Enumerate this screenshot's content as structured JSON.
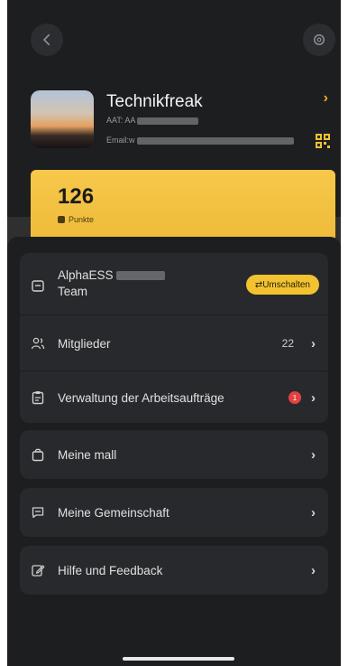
{
  "profile": {
    "name": "Technikfreak",
    "aat_prefix": "AAT: AA",
    "email_prefix": "Email:w"
  },
  "points": {
    "value": "126",
    "label": "Punkte"
  },
  "team": {
    "name_line1": "AlphaESS",
    "name_line2": "Team",
    "switch_label": "⇄Umschalten"
  },
  "menu": {
    "members_label": "Mitglieder",
    "members_count": "22",
    "work_orders_label": "Verwaltung der Arbeitsaufträge",
    "work_orders_badge": "1",
    "mall_label": "Meine mall",
    "community_label": "Meine Gemeinschaft",
    "help_label": "Hilfe und Feedback"
  },
  "colors": {
    "accent": "#f3c231",
    "background": "#1d1e20",
    "card": "#28292c",
    "badge": "#e34141"
  },
  "icons": {
    "back": "arrow-left-icon",
    "settings": "gear-icon",
    "qr": "qr-code-icon",
    "team": "team-icon",
    "members": "people-icon",
    "work_orders": "clipboard-icon",
    "mall": "shopping-bag-icon",
    "community": "chat-icon",
    "help": "edit-icon"
  }
}
